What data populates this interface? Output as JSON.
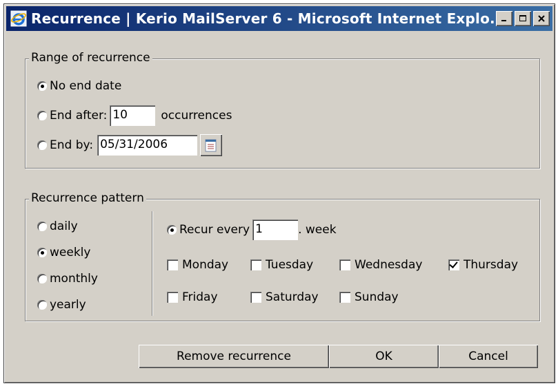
{
  "window": {
    "title": "Recurrence | Kerio MailServer 6 - Microsoft Internet Explo...",
    "titlebar_color": "#0a246a",
    "face_color": "#d4d0c8",
    "minimize_icon": "minimize-icon",
    "maximize_icon": "maximize-icon",
    "close_icon": "close-icon"
  },
  "range": {
    "legend": "Range of recurrence",
    "options": {
      "no_end": {
        "label": "No end date",
        "selected": true
      },
      "end_after": {
        "label": "End after:",
        "value": "10",
        "suffix": "occurrences",
        "selected": false
      },
      "end_by": {
        "label": "End by:",
        "value": "05/31/2006",
        "selected": false,
        "icon": "calendar-icon"
      }
    }
  },
  "pattern": {
    "legend": "Recurrence pattern",
    "frequencies": [
      {
        "label": "daily",
        "selected": false
      },
      {
        "label": "weekly",
        "selected": true
      },
      {
        "label": "monthly",
        "selected": false
      },
      {
        "label": "yearly",
        "selected": false
      }
    ],
    "recur": {
      "label": "Recur every",
      "value": "1",
      "suffix": ". week",
      "selected": true
    },
    "days": {
      "monday": {
        "label": "Monday",
        "checked": false
      },
      "tuesday": {
        "label": "Tuesday",
        "checked": false
      },
      "wednesday": {
        "label": "Wednesday",
        "checked": false
      },
      "thursday": {
        "label": "Thursday",
        "checked": true
      },
      "friday": {
        "label": "Friday",
        "checked": false
      },
      "saturday": {
        "label": "Saturday",
        "checked": false
      },
      "sunday": {
        "label": "Sunday",
        "checked": false
      }
    }
  },
  "buttons": {
    "remove": "Remove recurrence",
    "ok": "OK",
    "cancel": "Cancel"
  }
}
